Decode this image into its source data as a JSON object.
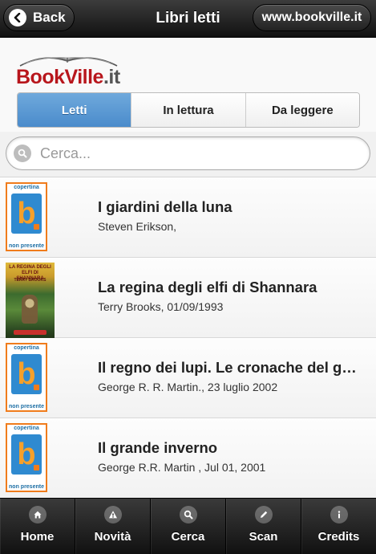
{
  "header": {
    "back_label": "Back",
    "title": "Libri letti",
    "site_label": "www.bookville.it"
  },
  "logo": {
    "text_main": "BookVille",
    "text_suffix": ".it"
  },
  "segments": [
    {
      "label": "Letti",
      "active": true
    },
    {
      "label": "In lettura",
      "active": false
    },
    {
      "label": "Da leggere",
      "active": false
    }
  ],
  "search": {
    "placeholder": "Cerca...",
    "value": ""
  },
  "placeholder_cover": {
    "top": "copertina",
    "letter": "b",
    "bottom": "non presente"
  },
  "art_cover": {
    "title": "LA REGINA DEGLI ELFI DI SHANNARA",
    "author": "TERRY BROOKS"
  },
  "books": [
    {
      "title": "I giardini della luna",
      "subtitle": "Steven Erikson,",
      "cover": "placeholder"
    },
    {
      "title": "La regina degli elfi di Shannara",
      "subtitle": "Terry Brooks, 01/09/1993",
      "cover": "art"
    },
    {
      "title": "Il regno dei lupi. Le cronache del ghiaccio e del fuoco",
      "subtitle": "George R. R. Martin., 23 luglio 2002",
      "cover": "placeholder"
    },
    {
      "title": "Il grande inverno",
      "subtitle": "George R.R. Martin , Jul 01, 2001",
      "cover": "placeholder"
    }
  ],
  "footer": {
    "tabs": [
      {
        "label": "Home",
        "icon": "home-icon"
      },
      {
        "label": "Novità",
        "icon": "alert-icon"
      },
      {
        "label": "Cerca",
        "icon": "search-icon"
      },
      {
        "label": "Scan",
        "icon": "pencil-icon"
      },
      {
        "label": "Credits",
        "icon": "info-icon"
      }
    ]
  },
  "colors": {
    "accent": "#4a8bcb",
    "brand_red": "#b8161c",
    "placeholder_orange": "#f07c1c",
    "placeholder_blue": "#2f8ad0"
  }
}
